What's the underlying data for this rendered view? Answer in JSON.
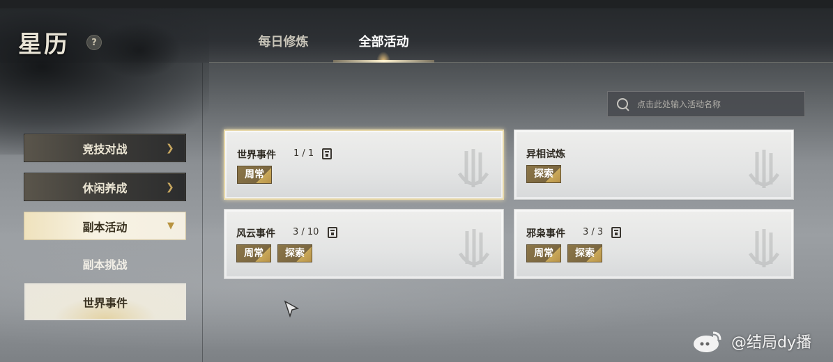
{
  "header": {
    "title": "星历",
    "help_symbol": "?",
    "tabs": [
      {
        "label": "每日修炼",
        "active": false
      },
      {
        "label": "全部活动",
        "active": true
      }
    ]
  },
  "search": {
    "placeholder": "点击此处输入活动名称",
    "value": ""
  },
  "sidebar": {
    "items": [
      {
        "label": "竞技对战",
        "icon": "chevron-right-icon",
        "state": "collapsed"
      },
      {
        "label": "休闲养成",
        "icon": "chevron-right-icon",
        "state": "collapsed"
      },
      {
        "label": "副本活动",
        "icon": "chevron-down-icon",
        "state": "expanded"
      },
      {
        "label": "副本挑战",
        "state": "sub-item"
      },
      {
        "label": "世界事件",
        "state": "sub-item-selected"
      }
    ]
  },
  "activities": [
    {
      "title": "世界事件",
      "count": "1 / 1",
      "icon": "calendar-icon",
      "tags": [
        "周常"
      ],
      "selected": true
    },
    {
      "title": "异相试炼",
      "count": "",
      "tags": [
        "探索"
      ],
      "selected": false
    },
    {
      "title": "风云事件",
      "count": "3 / 10",
      "icon": "calendar-icon",
      "tags": [
        "周常",
        "探索"
      ],
      "selected": false
    },
    {
      "title": "邪枭事件",
      "count": "3 / 3",
      "icon": "calendar-icon",
      "tags": [
        "周常",
        "探索"
      ],
      "selected": false
    }
  ],
  "watermark": {
    "text": "@结局dy播"
  },
  "colors": {
    "gold_accent": "#c9a860",
    "tag_bg": "#8c7648",
    "card_bg": "#e3e4e4"
  }
}
